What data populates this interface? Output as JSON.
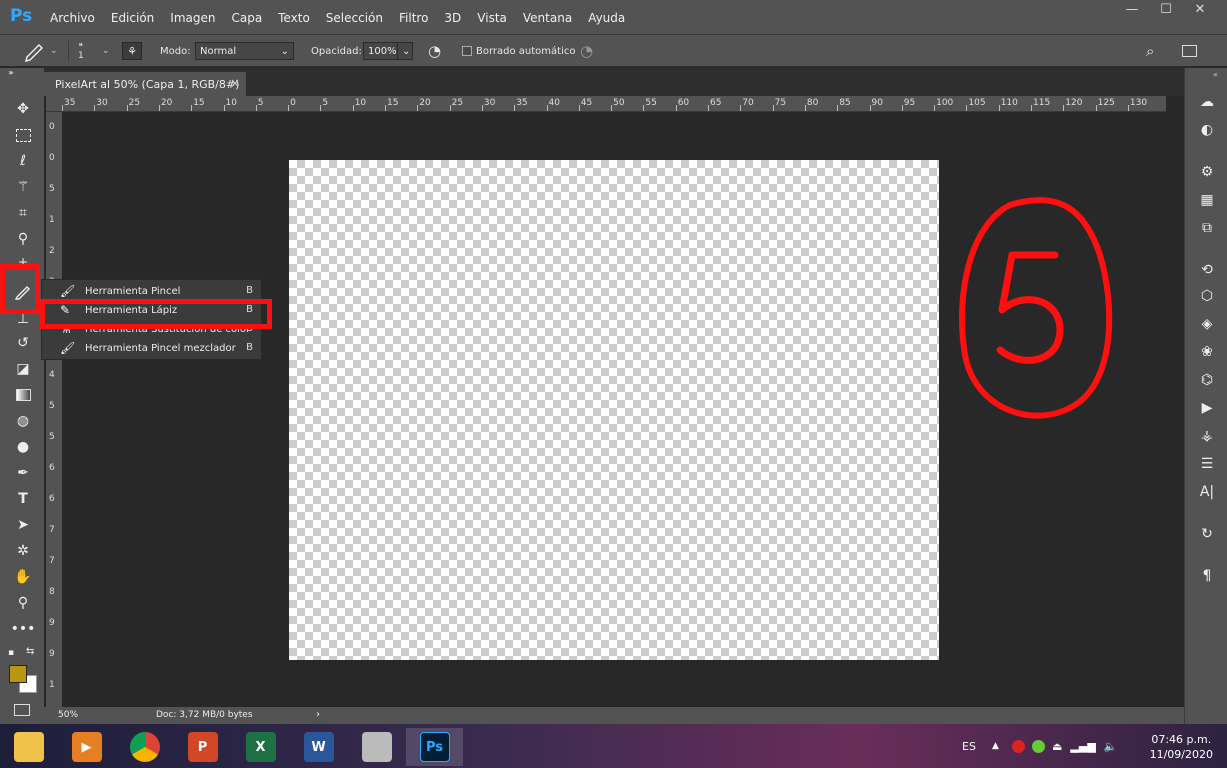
{
  "app": {
    "logo": "Ps"
  },
  "menu": [
    "Archivo",
    "Edición",
    "Imagen",
    "Capa",
    "Texto",
    "Selección",
    "Filtro",
    "3D",
    "Vista",
    "Ventana",
    "Ayuda"
  ],
  "window_controls": {
    "minimize": "—",
    "maximize": "☐",
    "close": "✕"
  },
  "options": {
    "brush_size": "1",
    "mode_label": "Modo:",
    "mode_value": "Normal",
    "opacity_label": "Opacidad:",
    "opacity_value": "100%",
    "auto_erase_label": "Borrado automático"
  },
  "document_tab": {
    "title": "PixelArt al 50% (Capa 1, RGB/8#)",
    "close": "×"
  },
  "ruler_h": [
    "35",
    "30",
    "25",
    "20",
    "15",
    "10",
    "5",
    "0",
    "5",
    "10",
    "15",
    "20",
    "25",
    "30",
    "35",
    "40",
    "45",
    "50",
    "55",
    "60",
    "65",
    "70",
    "75",
    "80",
    "85",
    "90",
    "95",
    "100",
    "105",
    "110",
    "115",
    "120",
    "125",
    "130"
  ],
  "ruler_v": [
    "0",
    "0",
    "5",
    "1",
    "2",
    "2",
    "3",
    "3",
    "4",
    "5",
    "5",
    "6",
    "6",
    "7",
    "7",
    "8",
    "9",
    "9",
    "1"
  ],
  "flyout": [
    {
      "icon": "brush-icon",
      "label": "Herramienta Pincel",
      "key": "B"
    },
    {
      "icon": "pencil-icon",
      "label": "Herramienta Lápiz",
      "key": "B"
    },
    {
      "icon": "color-replacement-icon",
      "label": "Herramienta Sustitución de color",
      "key": "B"
    },
    {
      "icon": "mixer-brush-icon",
      "label": "Herramienta Pincel mezclador",
      "key": "B"
    }
  ],
  "status": {
    "zoom": "50%",
    "doc": "Doc: 3,72 MB/0 bytes",
    "arrow": "›"
  },
  "annotation": {
    "text": "5"
  },
  "colors": {
    "foreground": "#b8960f",
    "background": "#ffffff",
    "annotation": "#ff1010"
  },
  "taskbar": {
    "language": "ES",
    "time": "07:46 p.m.",
    "date": "11/09/2020",
    "apps": [
      {
        "name": "file-explorer-icon",
        "text": ""
      },
      {
        "name": "media-player-icon",
        "text": "▶"
      },
      {
        "name": "chrome-icon",
        "text": ""
      },
      {
        "name": "powerpoint-icon",
        "text": "P"
      },
      {
        "name": "excel-icon",
        "text": "X"
      },
      {
        "name": "word-icon",
        "text": "W"
      },
      {
        "name": "calculator-icon",
        "text": ""
      },
      {
        "name": "photoshop-icon",
        "text": "Ps"
      }
    ]
  }
}
